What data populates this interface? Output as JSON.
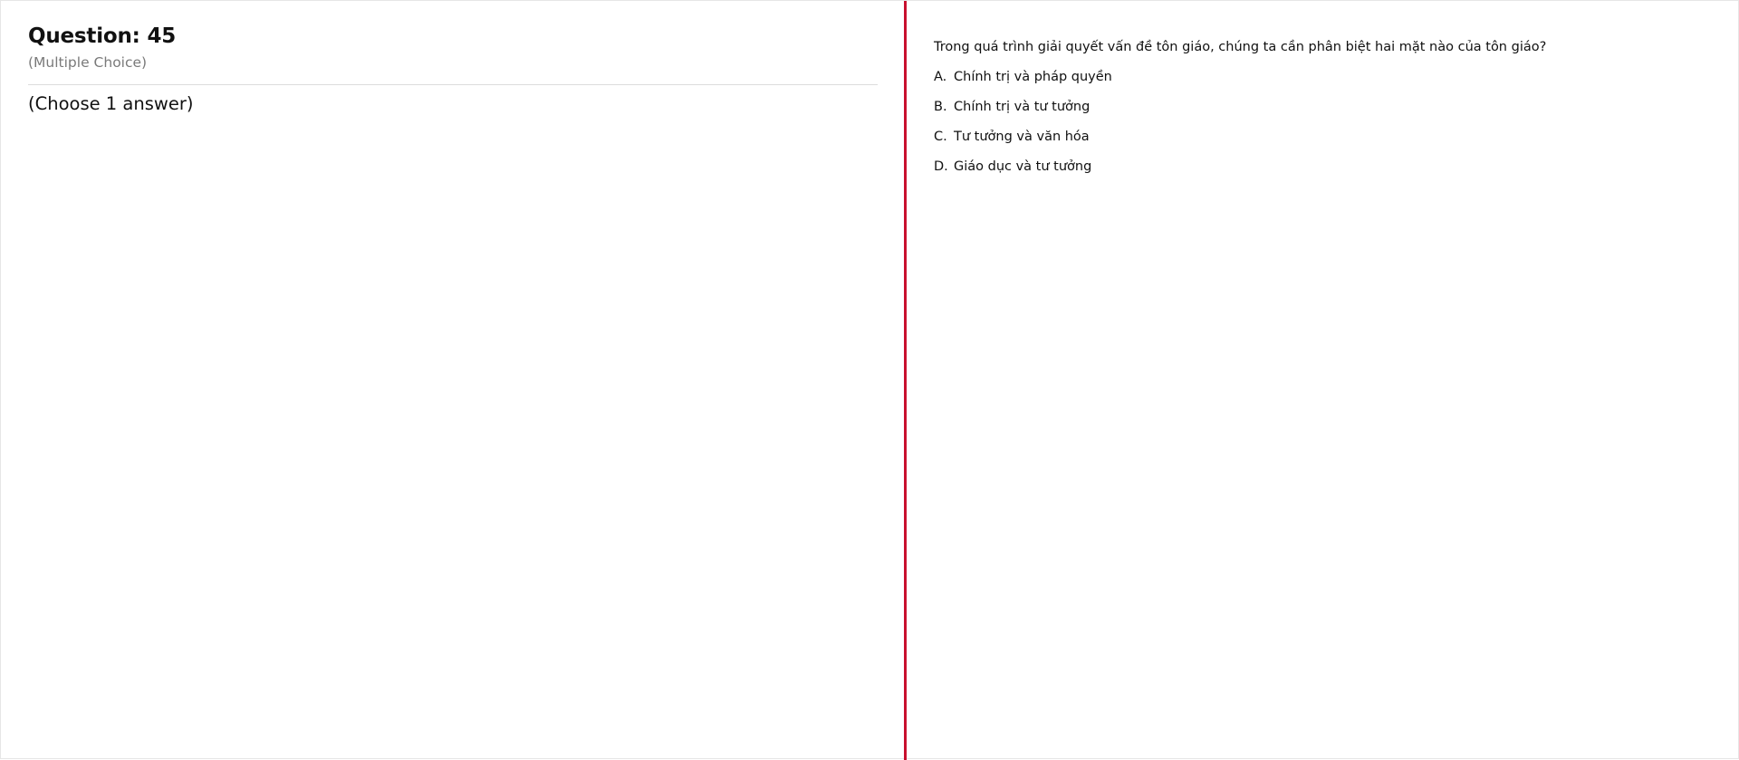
{
  "question": {
    "title": "Question: 45",
    "type": "(Multiple Choice)",
    "instruction": "(Choose 1 answer)",
    "text": "Trong quá trình giải quyết vấn đề tôn giáo, chúng ta cần phân biệt hai mặt nào của tôn giáo?",
    "options": [
      {
        "letter": "A.",
        "text": "Chính trị và pháp quyền"
      },
      {
        "letter": "B.",
        "text": "Chính trị và tư tưởng"
      },
      {
        "letter": "C.",
        "text": "Tư tưởng và văn hóa"
      },
      {
        "letter": "D.",
        "text": "Giáo dục và tư tưởng"
      }
    ]
  },
  "colors": {
    "splitter": "#c8102e",
    "subtitle": "#7a7a7a",
    "divider": "#dcdcdc"
  }
}
